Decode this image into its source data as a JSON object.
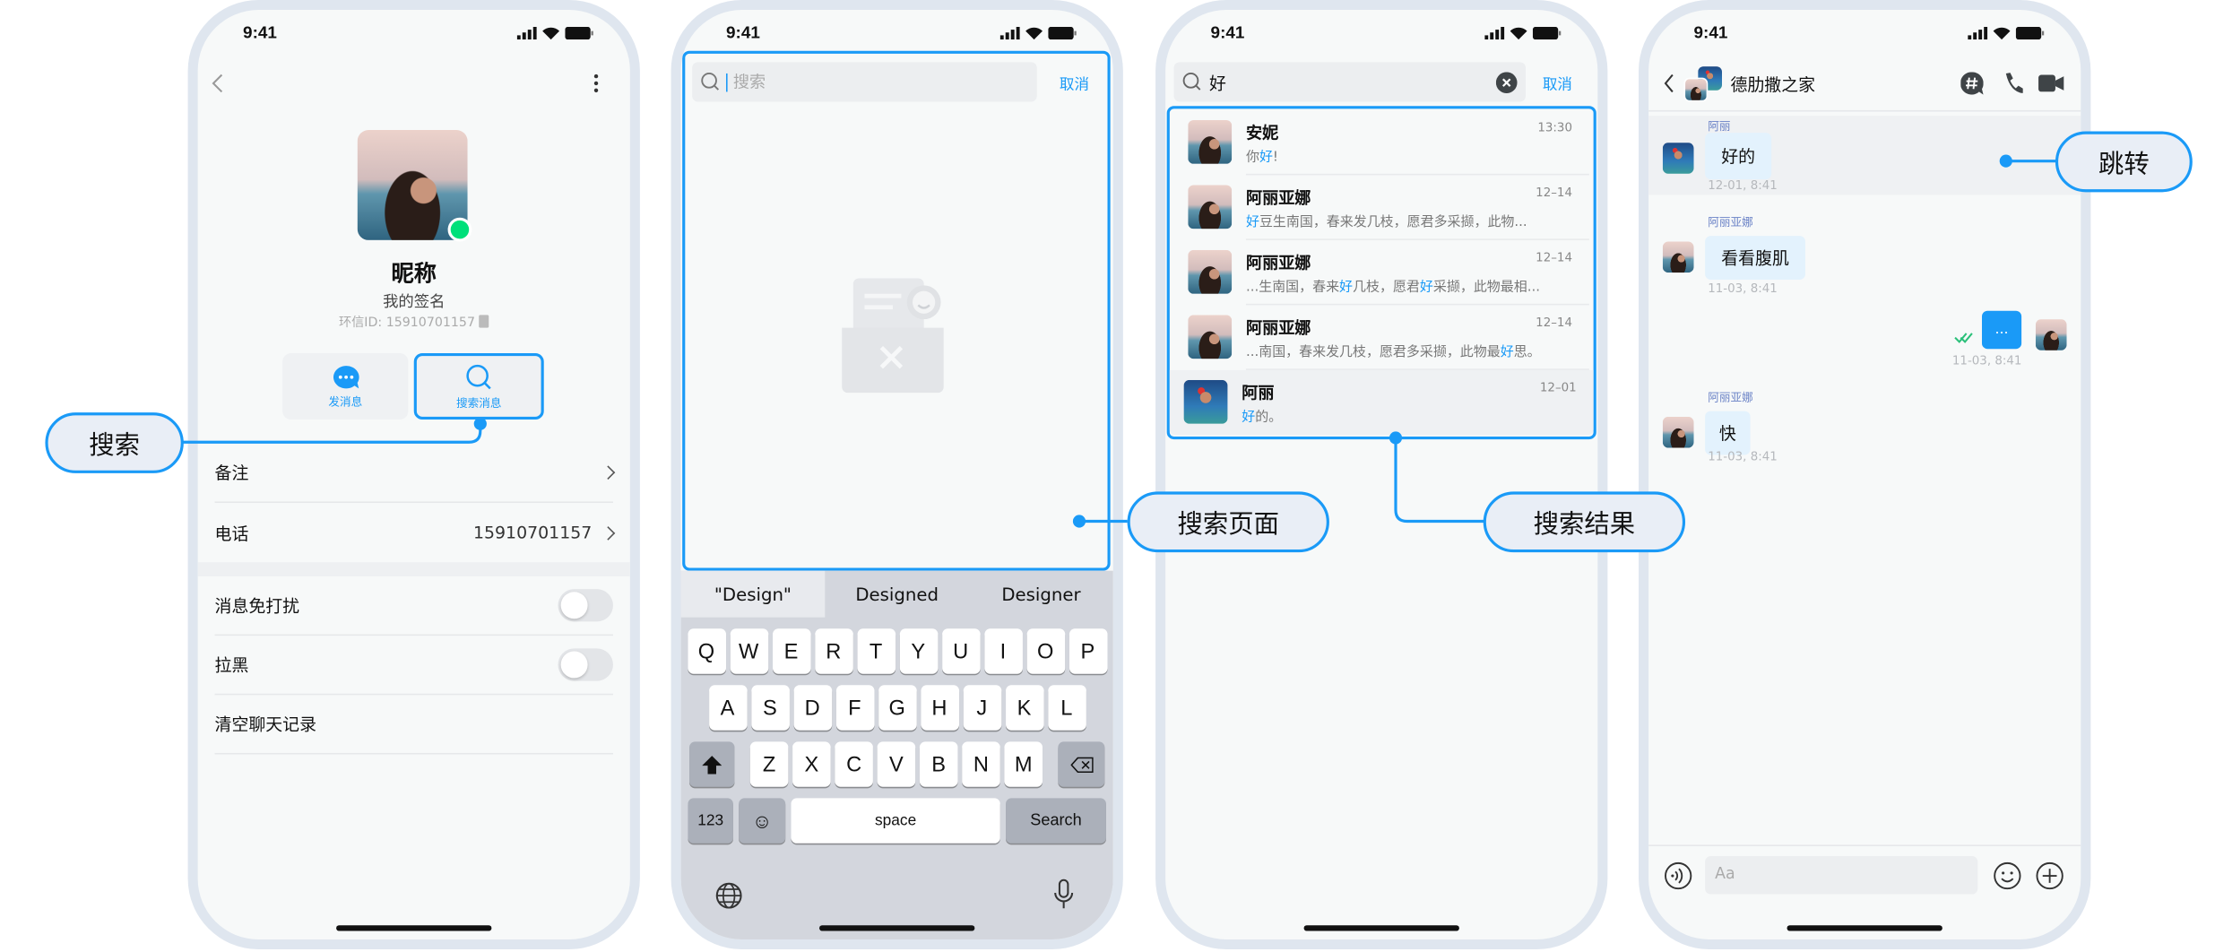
{
  "status": {
    "time": "9:41"
  },
  "accent_color": "#1a9af7",
  "profile": {
    "nickname": "昵称",
    "signature": "我的签名",
    "id_label": "环信ID: 15910701157",
    "online": true,
    "actions": [
      {
        "label": "发消息",
        "icon": "chat-bubble-icon"
      },
      {
        "label": "搜索消息",
        "icon": "search-icon"
      }
    ],
    "rows": [
      {
        "label": "备注",
        "value": ""
      },
      {
        "label": "电话",
        "value": "15910701157"
      }
    ],
    "toggles": [
      {
        "label": "消息免打扰",
        "on": false
      },
      {
        "label": "拉黑",
        "on": false
      }
    ],
    "clear_label": "清空聊天记录"
  },
  "search_page": {
    "placeholder": "搜索",
    "cancel": "取消",
    "suggestions": [
      "\"Design\"",
      "Designed",
      "Designer"
    ],
    "keys": {
      "row1": [
        "Q",
        "W",
        "E",
        "R",
        "T",
        "Y",
        "U",
        "I",
        "O",
        "P"
      ],
      "row2": [
        "A",
        "S",
        "D",
        "F",
        "G",
        "H",
        "J",
        "K",
        "L"
      ],
      "row3": [
        "Z",
        "X",
        "C",
        "V",
        "B",
        "N",
        "M"
      ],
      "numbers": "123",
      "space": "space",
      "search": "Search"
    }
  },
  "search_results": {
    "query": "好",
    "cancel": "取消",
    "items": [
      {
        "name": "安妮",
        "time": "13:30",
        "snippet": [
          {
            "t": "你",
            "h": false
          },
          {
            "t": "好",
            "h": true
          },
          {
            "t": "!",
            "h": false
          }
        ]
      },
      {
        "name": "阿丽亚娜",
        "time": "12–14",
        "snippet": [
          {
            "t": "好",
            "h": true
          },
          {
            "t": "豆生南国，春来发几枝，愿君多采撷，此物...",
            "h": false
          }
        ]
      },
      {
        "name": "阿丽亚娜",
        "time": "12–14",
        "snippet": [
          {
            "t": "...生南国，春来",
            "h": false
          },
          {
            "t": "好",
            "h": true
          },
          {
            "t": "几枝，愿君",
            "h": false
          },
          {
            "t": "好",
            "h": true
          },
          {
            "t": "采撷，此物最相...",
            "h": false
          }
        ]
      },
      {
        "name": "阿丽亚娜",
        "time": "12–14",
        "snippet": [
          {
            "t": "...南国，春来发几枝，愿君多采撷，此物最",
            "h": false
          },
          {
            "t": "好",
            "h": true
          },
          {
            "t": "思。",
            "h": false
          }
        ]
      },
      {
        "name": "阿丽",
        "time": "12–01",
        "snippet": [
          {
            "t": "好",
            "h": true
          },
          {
            "t": "的。",
            "h": false
          }
        ]
      }
    ]
  },
  "chat": {
    "title": "德肋撒之家",
    "messages": [
      {
        "sender": "阿丽",
        "text": "好的",
        "time": "12-01, 8:41"
      },
      {
        "sender": "阿丽亚娜",
        "text": "看看腹肌",
        "time": "11-03, 8:41"
      },
      {
        "sender": "",
        "text": "...",
        "time": "11-03, 8:41"
      },
      {
        "sender": "阿丽亚娜",
        "text": "快",
        "time": "11-03, 8:41"
      }
    ],
    "input_placeholder": "Aa"
  },
  "callouts": {
    "search": "搜索",
    "search_page": "搜索页面",
    "search_results": "搜索结果",
    "jump": "跳转"
  }
}
